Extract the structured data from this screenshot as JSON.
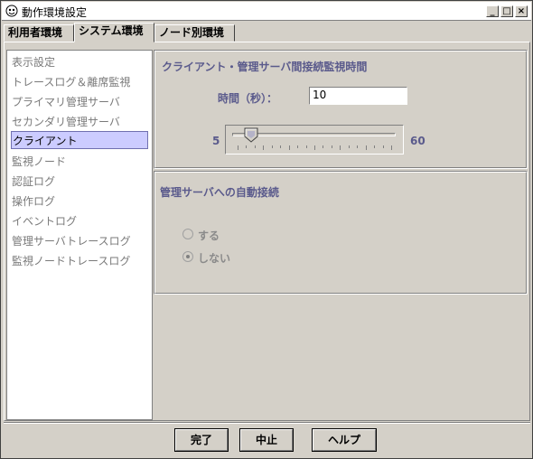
{
  "window": {
    "title": "動作環境設定"
  },
  "tabs": [
    {
      "label": "利用者環境"
    },
    {
      "label": "システム環境"
    },
    {
      "label": "ノード別環境"
    }
  ],
  "active_tab": "システム環境",
  "nav": {
    "items": [
      {
        "label": "表示設定"
      },
      {
        "label": "トレースログ＆離席監視"
      },
      {
        "label": "プライマリ管理サーバ"
      },
      {
        "label": "セカンダリ管理サーバ"
      },
      {
        "label": "クライアント"
      },
      {
        "label": "監視ノード"
      },
      {
        "label": "認証ログ"
      },
      {
        "label": "操作ログ"
      },
      {
        "label": "イベントログ"
      },
      {
        "label": "管理サーバトレースログ"
      },
      {
        "label": "監視ノードトレースログ"
      }
    ],
    "selected": "クライアント"
  },
  "client_panel": {
    "title": "クライアント・管理サーバ間接続監視時間",
    "time_label": "時間（秒）：",
    "time_value": "10",
    "slider": {
      "min_label": "5",
      "max_label": "60",
      "min": 5,
      "max": 60,
      "value": 10
    }
  },
  "auto_connect_panel": {
    "title": "管理サーバへの自動接続",
    "options": [
      {
        "label": "する",
        "selected": false
      },
      {
        "label": "しない",
        "selected": true
      }
    ]
  },
  "buttons": {
    "ok": "完了",
    "cancel": "中止",
    "help": "ヘルプ"
  },
  "colors": {
    "accent_text": "#5a5a8c",
    "selection": "#ccccff",
    "disabled_text": "#8a8a8a"
  }
}
